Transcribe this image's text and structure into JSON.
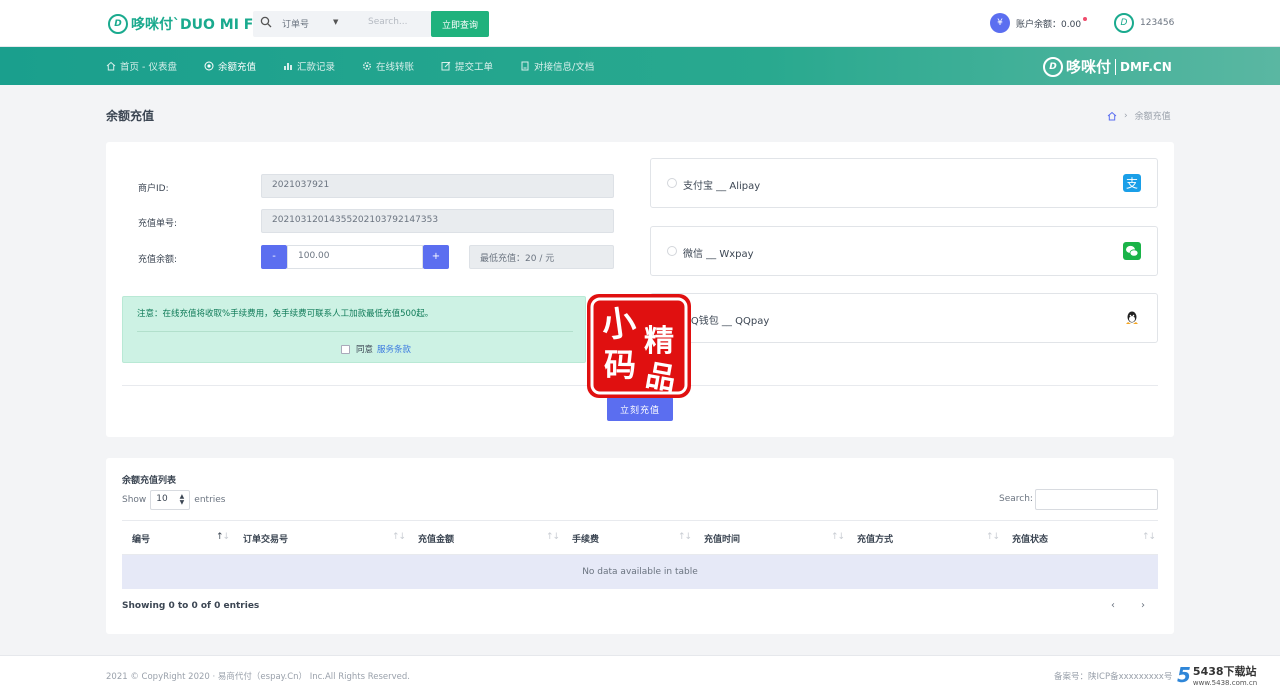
{
  "header": {
    "logo_badge": "D",
    "logo_text": "哆咪付`DUO MI FU",
    "search_type": "订单号",
    "search_placeholder": "Search...",
    "query_button": "立即查询",
    "balance_symbol": "¥",
    "balance_label": "账户余额：0.00",
    "username": "123456"
  },
  "nav": {
    "items": [
      {
        "label": "首页 - 仪表盘",
        "icon": "home-icon"
      },
      {
        "label": "余额充值",
        "icon": "target-icon",
        "active": true
      },
      {
        "label": "汇款记录",
        "icon": "chart-icon"
      },
      {
        "label": "在线转账",
        "icon": "gear-icon"
      },
      {
        "label": "提交工单",
        "icon": "edit-icon"
      },
      {
        "label": "对接信息/文档",
        "icon": "doc-icon"
      }
    ],
    "brand_cn": "哆咪付",
    "brand_en": "DMF.CN"
  },
  "page": {
    "title": "余额充值",
    "breadcrumb_current": "余额充值"
  },
  "form": {
    "merchant_label": "商户ID:",
    "merchant_value": "2021037921",
    "order_label": "充值单号:",
    "order_value": "20210312014355202103792147353",
    "amount_label": "充值余额:",
    "minus": "-",
    "plus": "+",
    "amount_value": "100.00",
    "min_charge": "最低充值：20 / 元",
    "notice": "注意：在线充值将收取%手续费用，免手续费可联系人工加款最低充值500起。",
    "agree_text": "同意",
    "terms_link": "服务条款",
    "submit": "立刻充值"
  },
  "payments": [
    {
      "name": "支付宝 __ Alipay",
      "icon": "alipay-icon",
      "color": "#1a9fe8"
    },
    {
      "name": "微信 __ Wxpay",
      "icon": "wechat-icon",
      "color": "#1ab348"
    },
    {
      "name": "QQ钱包 __ QQpay",
      "icon": "qq-icon",
      "color": "#222222"
    }
  ],
  "stamp": {
    "chars": [
      "小",
      "精",
      "码",
      "品"
    ],
    "color": "#e01010"
  },
  "table": {
    "title": "余额充值列表",
    "show_label": "Show",
    "page_size": "10",
    "entries_label": "entries",
    "search_label": "Search:",
    "columns": [
      "编号",
      "订单交易号",
      "充值金额",
      "手续费",
      "充值时间",
      "充值方式",
      "充值状态"
    ],
    "empty": "No data available in table",
    "info": "Showing 0 to 0 of 0 entries",
    "prev": "‹",
    "next": "›"
  },
  "footer": {
    "copyright": "2021 © CopyRight 2020 · 易商代付（espay.Cn） Inc.All Rights Reserved.",
    "icp": "备案号：陕ICP备xxxxxxxxx号",
    "watermark_num": "5",
    "watermark_text": "5438下载站",
    "watermark_url": "www.5438.com.cn"
  }
}
